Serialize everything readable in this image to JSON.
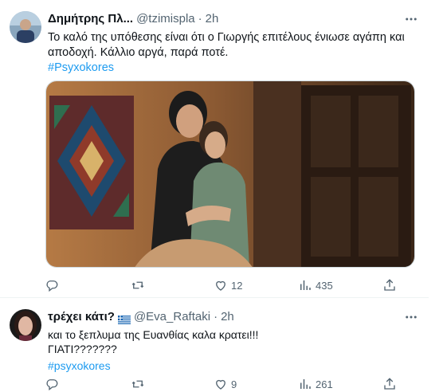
{
  "tweets": [
    {
      "name": "Δημήτρης Πλ...",
      "handle": "@tzimispla",
      "separator": "·",
      "time": "2h",
      "text_line1": "Το καλό της υπόθεσης είναι ότι ο Γιωργής επιτέλους ένιωσε αγάπη και",
      "text_line2": "αποδοχή. Κάλλιο αργά, παρά ποτέ.",
      "hashtag": "#Psyxokores",
      "actions": {
        "reply_count": "",
        "retweet_count": "",
        "like_count": "12",
        "views_count": "435"
      }
    },
    {
      "name": "τρέχει κάτι?",
      "handle": "@Eva_Raftaki",
      "separator": "·",
      "time": "2h",
      "text_line1": "και το ξεπλυμα της Ευανθίας καλα κρατει!!!",
      "text_line2": "ΓΙΑΤΙ???????",
      "hashtag": "#psyxokores",
      "actions": {
        "reply_count": "",
        "retweet_count": "",
        "like_count": "9",
        "views_count": "261"
      }
    }
  ],
  "icons": {
    "more": "more-dots-icon",
    "reply": "reply-icon",
    "retweet": "retweet-icon",
    "like": "like-icon",
    "views": "views-icon",
    "share": "share-icon",
    "flag": "greece-flag-icon"
  },
  "colors": {
    "link": "#1d9bf0",
    "secondary": "#536471",
    "text": "#0f1419"
  }
}
